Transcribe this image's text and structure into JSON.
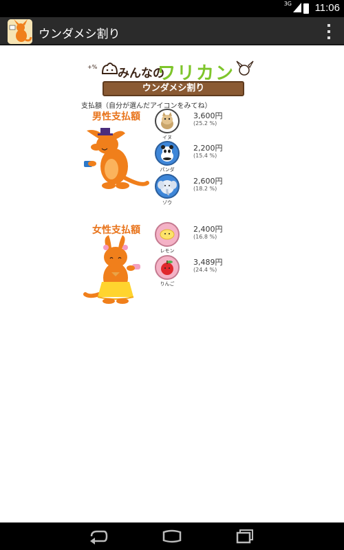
{
  "status_bar": {
    "time": "11:06",
    "network": "3G"
  },
  "action_bar": {
    "title": "ウンダメシ割り"
  },
  "header": {
    "logo_prefix": "みんなの",
    "logo_main": "ワリカン",
    "banner": "ウンダメシ割り",
    "caption": "支払額（自分が選んだアイコンをみてね）"
  },
  "male": {
    "heading": "男性支払額",
    "items": [
      {
        "icon": "dog-icon",
        "caption": "イヌ",
        "amount": "3,600円",
        "percent": "(25.2 %)"
      },
      {
        "icon": "panda-icon",
        "caption": "パンダ",
        "amount": "2,200円",
        "percent": "(15.4 %)"
      },
      {
        "icon": "elephant-icon",
        "caption": "ゾウ",
        "amount": "2,600円",
        "percent": "(18.2 %)"
      }
    ]
  },
  "female": {
    "heading": "女性支払額",
    "items": [
      {
        "icon": "lemon-icon",
        "caption": "レモン",
        "amount": "2,400円",
        "percent": "(16.8 %)"
      },
      {
        "icon": "apple-icon",
        "caption": "りんご",
        "amount": "3,489円",
        "percent": "(24.4 %)"
      }
    ]
  },
  "colors": {
    "accent": "#e8731a",
    "logo_green": "#7ec52b",
    "kangaroo": "#f07f1b"
  }
}
